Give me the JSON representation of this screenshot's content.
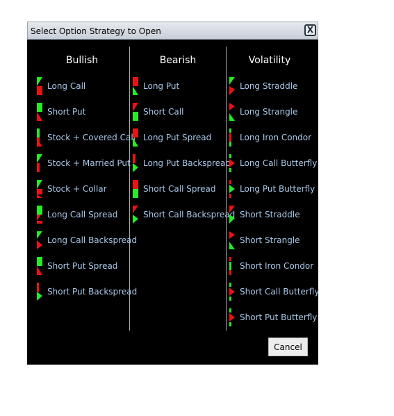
{
  "window": {
    "title": "Select Option Strategy to Open",
    "close_label": "X"
  },
  "colors": {
    "bull": "#22ee22",
    "bear": "#ee1111",
    "label": "#a9c8e9",
    "background": "#000000"
  },
  "columns": [
    {
      "header": "Bullish",
      "items": [
        {
          "label": "Long Call",
          "icon": "long-call-icon"
        },
        {
          "label": "Short Put",
          "icon": "short-put-icon"
        },
        {
          "label": "Stock + Covered Call",
          "icon": "stock-covered-call-icon"
        },
        {
          "label": "Stock + Married Put",
          "icon": "stock-married-put-icon"
        },
        {
          "label": "Stock + Collar",
          "icon": "stock-collar-icon"
        },
        {
          "label": "Long Call Spread",
          "icon": "long-call-spread-icon"
        },
        {
          "label": "Long Call Backspread",
          "icon": "long-call-backspread-icon"
        },
        {
          "label": "Short Put Spread",
          "icon": "short-put-spread-icon"
        },
        {
          "label": "Short Put Backspread",
          "icon": "short-put-backspread-icon"
        }
      ]
    },
    {
      "header": "Bearish",
      "items": [
        {
          "label": "Long Put",
          "icon": "long-put-icon"
        },
        {
          "label": "Short Call",
          "icon": "short-call-icon"
        },
        {
          "label": "Long Put Spread",
          "icon": "long-put-spread-icon"
        },
        {
          "label": "Long Put Backspread",
          "icon": "long-put-backspread-icon"
        },
        {
          "label": "Short Call Spread",
          "icon": "short-call-spread-icon"
        },
        {
          "label": "Short Call Backspread",
          "icon": "short-call-backspread-icon"
        }
      ]
    },
    {
      "header": "Volatility",
      "items": [
        {
          "label": "Long Straddle",
          "icon": "long-straddle-icon"
        },
        {
          "label": "Long Strangle",
          "icon": "long-strangle-icon"
        },
        {
          "label": "Long Iron Condor",
          "icon": "long-iron-condor-icon"
        },
        {
          "label": "Long Call Butterfly",
          "icon": "long-call-butterfly-icon"
        },
        {
          "label": "Long Put Butterfly",
          "icon": "long-put-butterfly-icon"
        },
        {
          "label": "Short Straddle",
          "icon": "short-straddle-icon"
        },
        {
          "label": "Short Strangle",
          "icon": "short-strangle-icon"
        },
        {
          "label": "Short Iron Condor",
          "icon": "short-iron-condor-icon"
        },
        {
          "label": "Short Call Butterfly",
          "icon": "short-call-butterfly-icon"
        },
        {
          "label": "Short Put Butterfly",
          "icon": "short-put-butterfly-icon"
        }
      ]
    }
  ],
  "footer": {
    "cancel_label": "Cancel"
  }
}
